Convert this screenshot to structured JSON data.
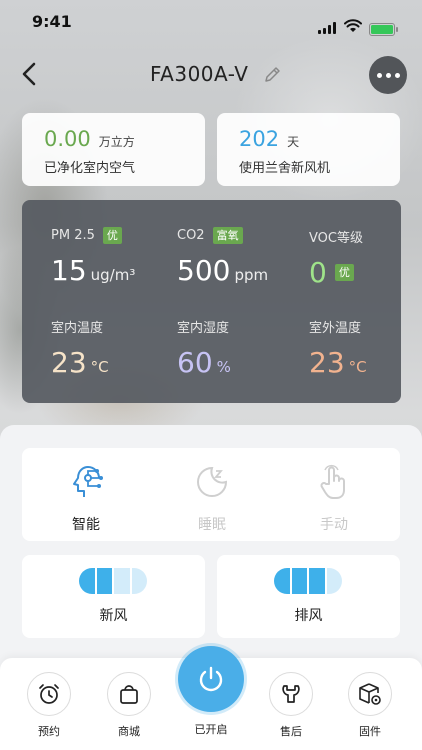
{
  "status_bar": {
    "time": "9:41"
  },
  "header": {
    "title": "FA300A-V"
  },
  "stats": {
    "purified": {
      "value": "0.00",
      "unit": "万立方",
      "desc": "已净化室内空气"
    },
    "days": {
      "value": "202",
      "unit": "天",
      "desc": "使用兰舍新风机"
    }
  },
  "metrics": {
    "pm25": {
      "label": "PM 2.5",
      "tag": "优",
      "value": "15",
      "unit": "ug/m³"
    },
    "co2": {
      "label": "CO2",
      "tag": "富氧",
      "value": "500",
      "unit": "ppm"
    },
    "voc": {
      "label": "VOC等级",
      "value": "0",
      "tag": "优"
    },
    "indoor_temp": {
      "label": "室内温度",
      "value": "23",
      "unit": "°C"
    },
    "indoor_humidity": {
      "label": "室内湿度",
      "value": "60",
      "unit": "%"
    },
    "outdoor_temp": {
      "label": "室外温度",
      "value": "23",
      "unit": "°C"
    }
  },
  "metric_colors": {
    "indoor_temp": "#f6e3c8",
    "indoor_humidity": "#c7c3f4",
    "outdoor_temp": "#f2b38f",
    "good_tag": "#6aa84f"
  },
  "modes": [
    {
      "label": "智能",
      "icon": "smart-head-icon",
      "active": true
    },
    {
      "label": "睡眠",
      "icon": "moon-zz-icon",
      "active": false
    },
    {
      "label": "手动",
      "icon": "hand-tap-icon",
      "active": false
    }
  ],
  "fans": {
    "fresh": {
      "label": "新风",
      "level_of_4": 2
    },
    "exhaust": {
      "label": "排风",
      "level_of_4": 3
    }
  },
  "tabbar": {
    "schedule": "预约",
    "shop": "商城",
    "power": "已开启",
    "service": "售后",
    "firmware": "固件"
  },
  "colors": {
    "accent": "#4aaee8",
    "green": "#6aa84f",
    "blue": "#3aa3e0"
  }
}
